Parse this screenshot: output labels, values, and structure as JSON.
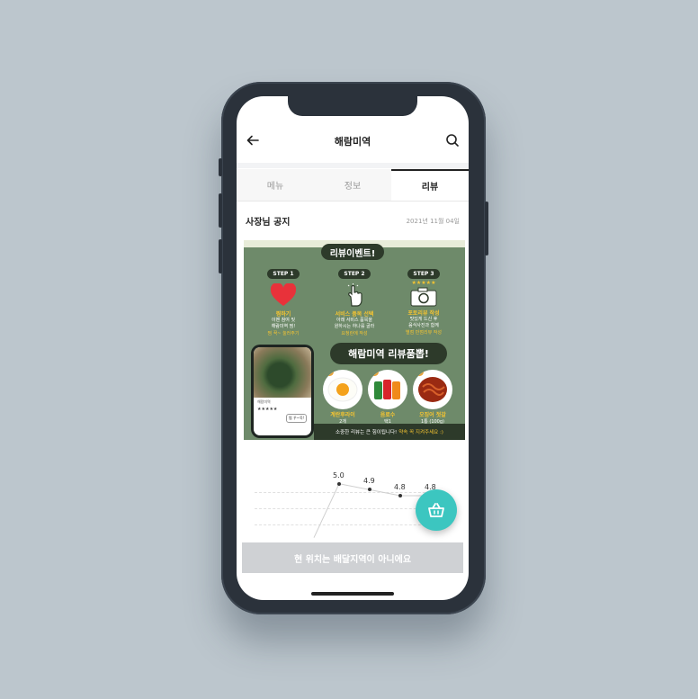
{
  "header": {
    "title": "해람미역"
  },
  "tabs": [
    {
      "label": "메뉴",
      "active": false
    },
    {
      "label": "정보",
      "active": false
    },
    {
      "label": "리뷰",
      "active": true
    }
  ],
  "notice": {
    "title": "사장님 공지",
    "date": "2021년 11월 04일"
  },
  "banner": {
    "title": "리뷰이벤트!",
    "steps": [
      {
        "label": "STEP 1",
        "name": "찜하기",
        "desc1": "이벤 참여 및",
        "desc2": "해람미역 찜!",
        "hl": "찜 꾹~ 눌러주기"
      },
      {
        "label": "STEP 2",
        "name": "서비스 품목 선택",
        "desc1": "아래 서비스 품목을",
        "desc2": "원하시는 하나를 골라",
        "hl": "요청란에 작성"
      },
      {
        "label": "STEP 3",
        "name": "포토리뷰 작성",
        "desc1": "맛있게 드신 후",
        "desc2": "음식사진과 함께",
        "hl": "별점 만점리뷰 작성",
        "stars": "★★★★★"
      }
    ],
    "mini_phone": {
      "name": "해람미역",
      "stars": "★★★★★",
      "bubble": "찜 꾸~욱!"
    },
    "event_title": "해람미역 리뷰품뽑!",
    "prizes": [
      {
        "rank": "1번",
        "name": "계란후라이",
        "sub": "2개"
      },
      {
        "rank": "2번",
        "name": "음료수",
        "sub": "택1"
      },
      {
        "rank": "3번",
        "name": "오징어 젓갈",
        "sub": "1통 (100g)"
      }
    ],
    "footer_text": "소중한 리뷰는 큰 힘이됩니다!",
    "footer_highlight": "약속 꼭 지켜주세요 :)"
  },
  "chart_data": {
    "type": "line",
    "x": [
      1,
      2,
      3,
      4
    ],
    "values": [
      5.0,
      4.9,
      4.8,
      4.8
    ],
    "labels": [
      "5.0",
      "4.9",
      "4.8",
      "4.8"
    ],
    "title": "",
    "xlabel": "",
    "ylabel": "",
    "grid": true
  },
  "bottom_button": {
    "label": "현 위치는 배달지역이 아니에요"
  },
  "colors": {
    "accent": "#3cc6c0",
    "banner_green": "#6e8a6a",
    "highlight": "#f5c431"
  },
  "icons": {
    "back": "arrow-left-icon",
    "search": "search-icon",
    "cart": "basket-icon"
  }
}
